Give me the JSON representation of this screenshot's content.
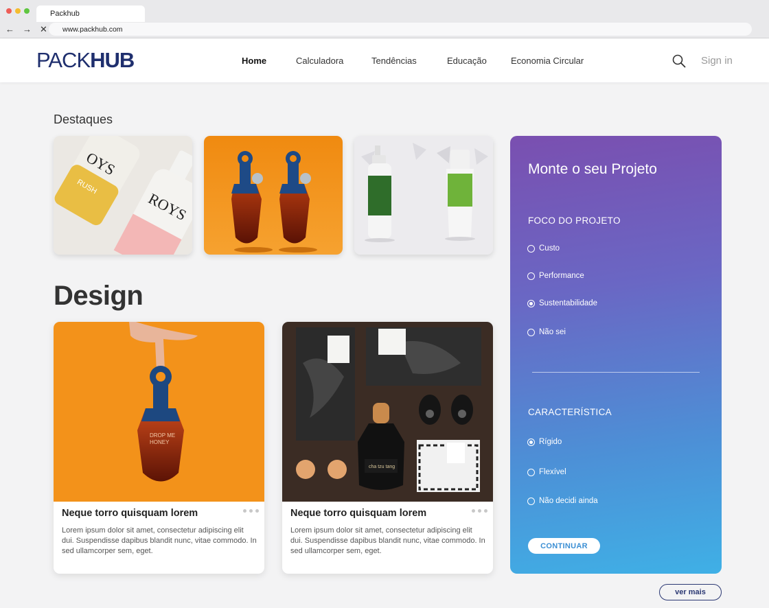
{
  "browser": {
    "tab_title": "Packhub",
    "url": "www.packhub.com",
    "back_glyph": "←",
    "forward_glyph": "→",
    "stop_glyph": "✕"
  },
  "header": {
    "logo_part1": "PACK",
    "logo_part2": "HUB",
    "nav": [
      {
        "label": "Home",
        "active": true
      },
      {
        "label": "Calculadora"
      },
      {
        "label": "Tendências"
      },
      {
        "label": "Educação"
      },
      {
        "label": "Economia Circular"
      }
    ],
    "signin": "Sign in"
  },
  "featured": {
    "heading": "Destaques",
    "items": [
      {
        "id": "roys-bottles"
      },
      {
        "id": "honey-bottles-orange"
      },
      {
        "id": "green-tubes"
      }
    ]
  },
  "design": {
    "heading": "Design",
    "cards": [
      {
        "title": "Neque torro quisquam lorem",
        "text": "Lorem ipsum dolor sit amet, consectetur adipiscing elit dui. Suspendisse dapibus blandit nunc, vitae commodo. In sed ullamcorper sem, eget."
      },
      {
        "title": "Neque torro quisquam lorem",
        "text": "Lorem ipsum dolor sit amet, consectetur adipiscing elit dui. Suspendisse dapibus blandit nunc, vitae commodo. In sed ullamcorper sem, eget."
      }
    ],
    "more_button": "ver mais"
  },
  "project_panel": {
    "title": "Monte o seu Projeto",
    "section1_title": "FOCO DO PROJETO",
    "section1_options": [
      {
        "label": "Custo",
        "selected": false
      },
      {
        "label": "Performance",
        "selected": false
      },
      {
        "label": "Sustentabilidade",
        "selected": true
      },
      {
        "label": "Não sei",
        "selected": false
      }
    ],
    "section2_title": "CARACTERÍSTICA",
    "section2_options": [
      {
        "label": "Rígido",
        "selected": true
      },
      {
        "label": "Flexível",
        "selected": false
      },
      {
        "label": "Não decidi ainda",
        "selected": false
      }
    ],
    "button": "CONTINUAR"
  },
  "colors": {
    "brand_navy": "#1f2f6e",
    "panel_top": "#7a4fb0",
    "panel_bottom": "#3fb0e6",
    "orange": "#f39a1f"
  }
}
